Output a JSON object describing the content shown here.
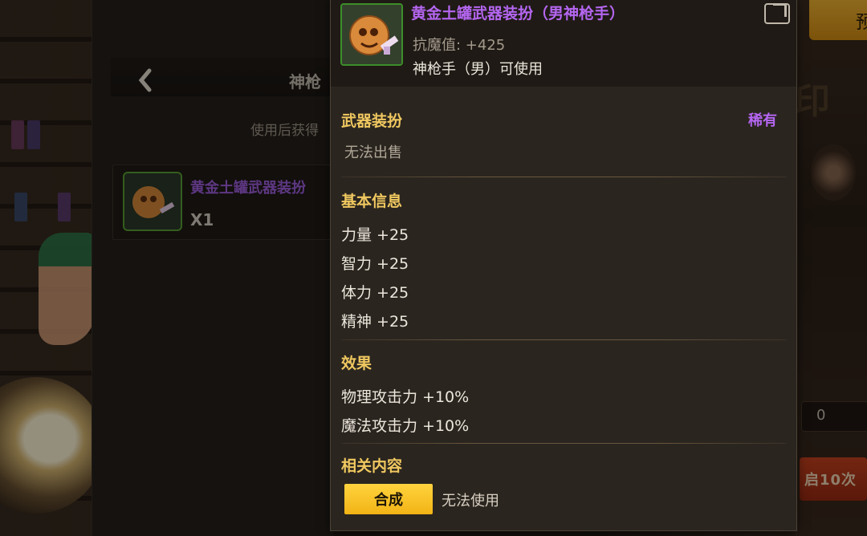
{
  "background": {
    "top_button_label": "预",
    "counter_value": "0",
    "red_button_label": "启10次",
    "faded_title": "印"
  },
  "mid_dialog": {
    "back_icon": "chevron-left-icon",
    "title": "神枪",
    "subtitle": "使用后获得",
    "item": {
      "name": "黄金土罐武器装扮",
      "quantity": "X1"
    }
  },
  "tooltip": {
    "item_name": "黄金土罐武器装扮（男神枪手）",
    "anti_magic": "抗魔值: +425",
    "usable_by": "神枪手（男）可使用",
    "share_icon": "share-icon",
    "category": "武器装扮",
    "rarity": "稀有",
    "sell_status": "无法出售",
    "basic_info_title": "基本信息",
    "stats": [
      "力量 +25",
      "智力 +25",
      "体力 +25",
      "精神 +25"
    ],
    "effect_title": "效果",
    "effects": [
      "物理攻击力 +10%",
      "魔法攻击力 +10%"
    ],
    "related_title": "相关内容",
    "synthesize_button": "合成",
    "use_status": "无法使用"
  },
  "colors": {
    "rarity_purple": "#b466f0",
    "section_gold": "#f0c860",
    "button_yellow": "#f2b415"
  }
}
